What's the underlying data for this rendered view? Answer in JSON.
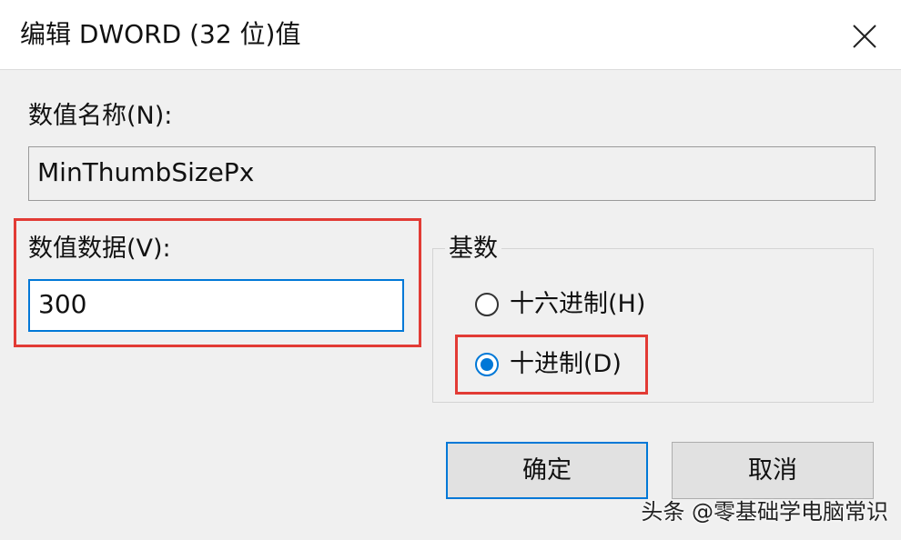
{
  "dialog": {
    "title": "编辑 DWORD (32 位)值",
    "close_icon": "close-icon"
  },
  "value_name": {
    "label": "数值名称(N):",
    "value": "MinThumbSizePx"
  },
  "value_data": {
    "label": "数值数据(V):",
    "value": "300"
  },
  "base": {
    "label": "基数",
    "options": [
      {
        "label": "十六进制(H)",
        "checked": false
      },
      {
        "label": "十进制(D)",
        "checked": true
      }
    ]
  },
  "buttons": {
    "ok_label": "确定",
    "cancel_label": "取消"
  },
  "watermark": "头条 @零基础学电脑常识",
  "colors": {
    "accent": "#0078d7",
    "highlight": "#e23b35",
    "dialog_bg": "#f0f0f0"
  }
}
